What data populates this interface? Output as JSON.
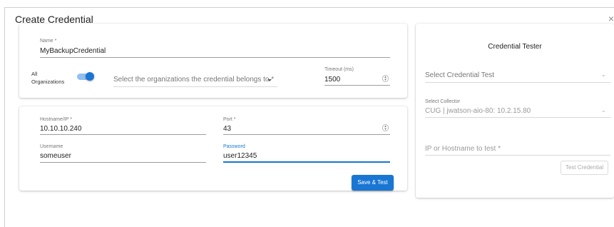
{
  "dialog": {
    "title": "Create Credential",
    "close_glyph": "×"
  },
  "main_form": {
    "name": {
      "label": "Name *",
      "value": "MyBackupCredential"
    },
    "all_orgs": {
      "label_line1": "All",
      "label_line2": "Organizations",
      "checked": true
    },
    "organizations": {
      "placeholder": "Select the organizations the credential belongs to *"
    },
    "timeout": {
      "label": "Timeout (ms)",
      "value": "1500"
    }
  },
  "connection": {
    "hostname": {
      "label": "Hostname/IP *",
      "value": "10.10.10.240"
    },
    "port": {
      "label": "Port *",
      "value": "43"
    },
    "username": {
      "label": "Username",
      "value": "someuser"
    },
    "password": {
      "label": "Password",
      "value": "user12345"
    },
    "save_test_label": "Save & Test"
  },
  "tester": {
    "title": "Credential Tester",
    "credential_test": {
      "placeholder": "Select Credential Test"
    },
    "collector": {
      "label": "Select Collector",
      "value": "CUG | jwatson-aio-80: 10.2.15.80"
    },
    "ip_host": {
      "placeholder": "IP or Hostname to test *"
    },
    "test_button_label": "Test Credential"
  },
  "icons": {
    "caret": "caret-down-icon",
    "chevron": "chevron-down-icon",
    "stepper": "number-stepper-icon",
    "close": "close-icon"
  },
  "colors": {
    "primary": "#1976d2",
    "toggle_track": "#90bff0"
  }
}
